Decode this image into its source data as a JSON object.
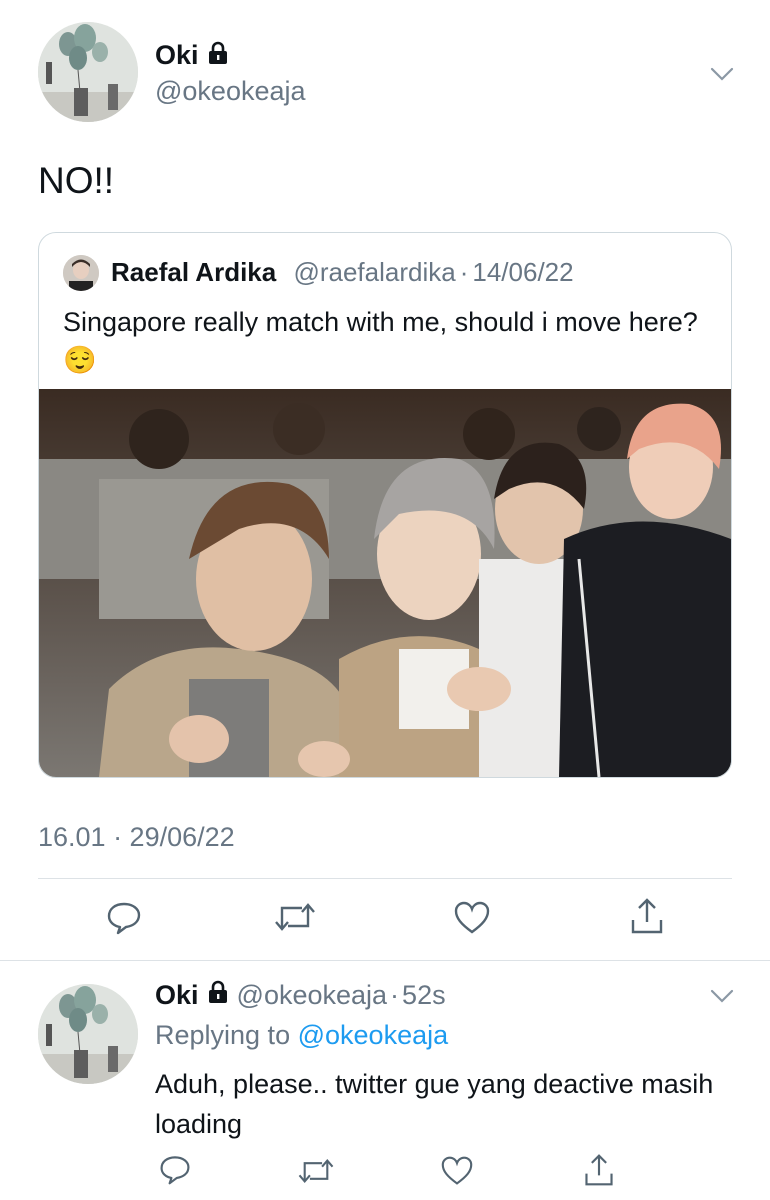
{
  "main_tweet": {
    "display_name": "Oki",
    "handle": "@okeokeaja",
    "text": "NO!!",
    "timestamp": "16.01 · 29/06/22",
    "quoted": {
      "display_name": "Raefal Ardika",
      "handle": "@raefalardika",
      "separator": "·",
      "date": "14/06/22",
      "text": "Singapore really match with me, should i move here?",
      "emoji": "😌"
    }
  },
  "reply": {
    "display_name": "Oki",
    "handle": "@okeokeaja",
    "separator": "·",
    "time": "52s",
    "replying_prefix": "Replying to",
    "replying_handle": "@okeokeaja",
    "text": "Aduh, please.. twitter gue yang deactive masih loading"
  },
  "colors": {
    "link": "#1d9bf0",
    "muted": "#687684",
    "text": "#0f1419"
  },
  "icons": [
    "lock-icon",
    "chevron-down-icon",
    "reply-icon",
    "retweet-icon",
    "like-icon",
    "share-icon"
  ]
}
